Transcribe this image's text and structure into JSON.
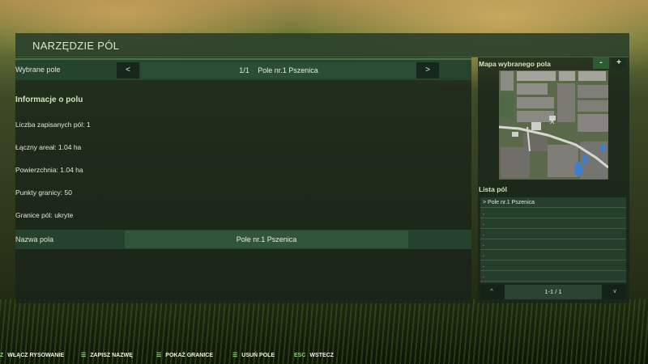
{
  "window": {
    "title": "NARZĘDZIE PÓL"
  },
  "selector": {
    "label": "Wybrane pole",
    "prev": "<",
    "next": ">",
    "page": "1/1",
    "value": "Pole nr.1 Pszenica"
  },
  "info": {
    "heading": "Informacje o polu",
    "lines": [
      "Liczba zapisanych pól: 1",
      "Łączny areał: 1.04 ha",
      "Powierzchnia: 1.04 ha",
      "Punkty granicy: 50",
      "Granice pól: ukryte"
    ]
  },
  "name_field": {
    "label": "Nazwa pola",
    "value": "Pole nr.1 Pszenica"
  },
  "map_panel": {
    "heading": "Mapa wybranego pola",
    "zoom_out": "-",
    "zoom_in": "+",
    "marker": "X"
  },
  "field_list": {
    "heading": "Lista pól",
    "items": [
      "> Pole nr.1 Pszenica",
      ".",
      ".",
      ".",
      ".",
      ".",
      ".",
      "."
    ],
    "up": "^",
    "down": "v",
    "pagination": "1-1 / 1"
  },
  "footer": {
    "actions": [
      {
        "key": "Z",
        "label": "WŁĄCZ RYSOWANIE"
      },
      {
        "key": "",
        "label": "ZAPISZ NAZWĘ"
      },
      {
        "key": "",
        "label": "POKAŻ GRANICE"
      },
      {
        "key": "",
        "label": "USUŃ POLE"
      },
      {
        "key": "ESC",
        "label": "WSTECZ"
      }
    ]
  },
  "colors": {
    "accent": "#cde7b6",
    "panel": "#18241a",
    "row_highlight": "#264630",
    "zoom_in_bg": "#1d2e20",
    "zoom_out_bg": "#2f5a34"
  }
}
